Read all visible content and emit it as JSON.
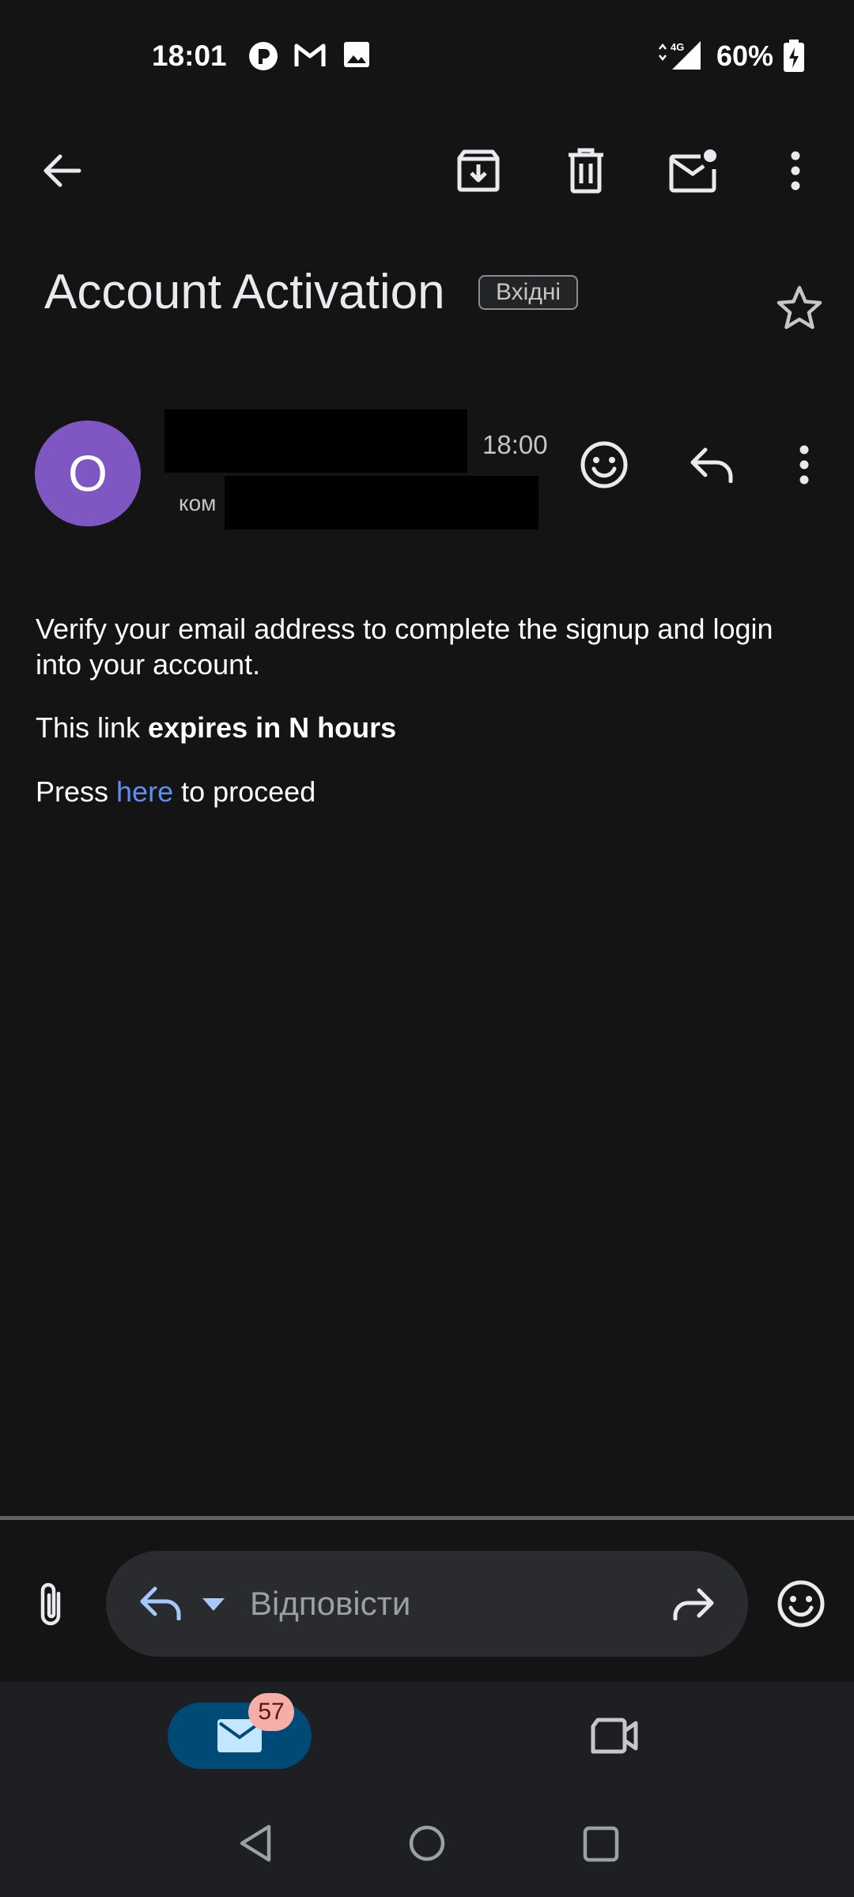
{
  "status_bar": {
    "time": "18:01",
    "battery": "60%",
    "network": "4G",
    "icons": [
      "app-notification-icon",
      "gmail-icon",
      "image-icon",
      "signal-icon",
      "battery-charging-icon"
    ]
  },
  "toolbar": {
    "actions": [
      "back-icon",
      "archive-icon",
      "delete-icon",
      "mark-unread-icon",
      "more-vert-icon"
    ]
  },
  "email": {
    "subject": "Account Activation",
    "label": "Вхідні",
    "sender_initial": "O",
    "time": "18:00",
    "recipient_prefix": "ком",
    "body": {
      "line1": "Verify your email address to complete the signup and login into your account.",
      "line2_prefix": "This link ",
      "line2_bold": "expires in N hours",
      "line3_prefix": "Press ",
      "line3_link": "here",
      "line3_suffix": " to proceed"
    }
  },
  "reply_bar": {
    "placeholder": "Відповісти"
  },
  "bottom_nav": {
    "mail_badge": "57"
  },
  "colors": {
    "background": "#141414",
    "avatar": "#7e57c2",
    "link": "#5c8ff0",
    "mail_pill": "#004a77",
    "badge": "#f6aea9"
  }
}
